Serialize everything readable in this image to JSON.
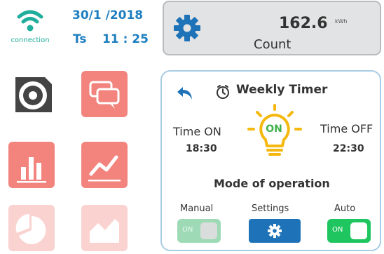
{
  "status": {
    "connection_label": "connection",
    "date": "30/1  /2018",
    "ts_label": "Ts",
    "time": "11 : 25"
  },
  "counter": {
    "value": "162.6",
    "unit": "kWh",
    "label": "Count"
  },
  "tiles": [
    {
      "icon": "disc-icon"
    },
    {
      "icon": "chat-icon"
    },
    {
      "icon": "bar-chart-icon"
    },
    {
      "icon": "line-chart-icon"
    },
    {
      "icon": "pie-chart-icon"
    },
    {
      "icon": "area-chart-icon"
    }
  ],
  "timer": {
    "title": "Weekly Timer",
    "time_on_label": "Time ON",
    "time_on_value": "18:30",
    "time_off_label": "Time OFF",
    "time_off_value": "22:30",
    "bulb_state": "ON",
    "mode_title": "Mode of operation",
    "manual_label": "Manual",
    "settings_label": "Settings",
    "auto_label": "Auto",
    "manual_switch_text": "ON",
    "auto_switch_text": "ON"
  },
  "colors": {
    "accent_blue": "#1e7fc0",
    "teal": "#1fae9b",
    "tile_red": "#f3837d",
    "bulb_yellow": "#f5b80f",
    "green_on": "#1fc55e"
  }
}
